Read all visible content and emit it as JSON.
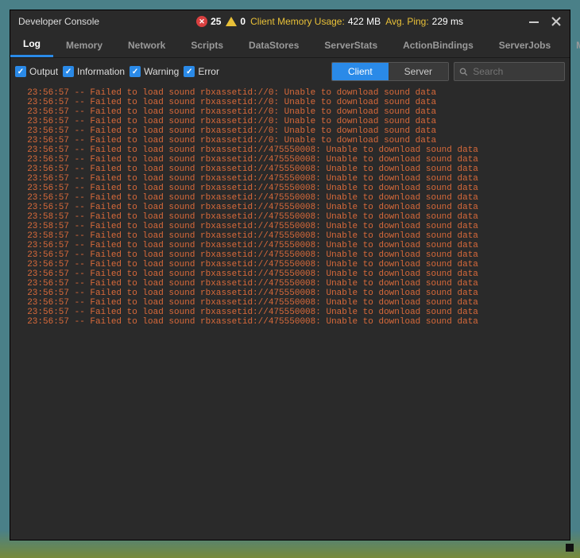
{
  "window": {
    "title": "Developer Console",
    "error_count": "25",
    "warn_count": "0",
    "mem_label": "Client Memory Usage:",
    "mem_value": "422 MB",
    "ping_label": "Avg. Ping:",
    "ping_value": "229 ms"
  },
  "tabs": [
    {
      "label": "Log",
      "active": true
    },
    {
      "label": "Memory",
      "active": false
    },
    {
      "label": "Network",
      "active": false
    },
    {
      "label": "Scripts",
      "active": false
    },
    {
      "label": "DataStores",
      "active": false
    },
    {
      "label": "ServerStats",
      "active": false
    },
    {
      "label": "ActionBindings",
      "active": false
    },
    {
      "label": "ServerJobs",
      "active": false
    },
    {
      "label": "MicroProfiler",
      "active": false
    }
  ],
  "filters": {
    "output": "Output",
    "information": "Information",
    "warning": "Warning",
    "error": "Error"
  },
  "segments": {
    "client": "Client",
    "server": "Server"
  },
  "search": {
    "placeholder": "Search"
  },
  "log_lines": [
    "  23:56:57 -- Failed to load sound rbxassetid://0: Unable to download sound data",
    "  23:56:57 -- Failed to load sound rbxassetid://0: Unable to download sound data",
    "  23:56:57 -- Failed to load sound rbxassetid://0: Unable to download sound data",
    "  23:56:57 -- Failed to load sound rbxassetid://0: Unable to download sound data",
    "  23:56:57 -- Failed to load sound rbxassetid://0: Unable to download sound data",
    "  23:56:57 -- Failed to load sound rbxassetid://0: Unable to download sound data",
    "  23:56:57 -- Failed to load sound rbxassetid://475550008: Unable to download sound data",
    "  23:56:57 -- Failed to load sound rbxassetid://475550008: Unable to download sound data",
    "  23:56:57 -- Failed to load sound rbxassetid://475550008: Unable to download sound data",
    "  23:56:57 -- Failed to load sound rbxassetid://475550008: Unable to download sound data",
    "  23:56:57 -- Failed to load sound rbxassetid://475550008: Unable to download sound data",
    "  23:56:57 -- Failed to load sound rbxassetid://475550008: Unable to download sound data",
    "  23:56:57 -- Failed to load sound rbxassetid://475550008: Unable to download sound data",
    "  23:58:57 -- Failed to load sound rbxassetid://475550008: Unable to download sound data",
    "  23:58:57 -- Failed to load sound rbxassetid://475550008: Unable to download sound data",
    "  23:58:57 -- Failed to load sound rbxassetid://475550008: Unable to download sound data",
    "  23:56:57 -- Failed to load sound rbxassetid://475550008: Unable to download sound data",
    "  23:56:57 -- Failed to load sound rbxassetid://475550008: Unable to download sound data",
    "  23:56:57 -- Failed to load sound rbxassetid://475550008: Unable to download sound data",
    "  23:56:57 -- Failed to load sound rbxassetid://475550008: Unable to download sound data",
    "  23:56:57 -- Failed to load sound rbxassetid://475550008: Unable to download sound data",
    "  23:56:57 -- Failed to load sound rbxassetid://475550008: Unable to download sound data",
    "  23:56:57 -- Failed to load sound rbxassetid://475550008: Unable to download sound data",
    "  23:56:57 -- Failed to load sound rbxassetid://475550008: Unable to download sound data",
    "  23:56:57 -- Failed to load sound rbxassetid://475550008: Unable to download sound data"
  ]
}
